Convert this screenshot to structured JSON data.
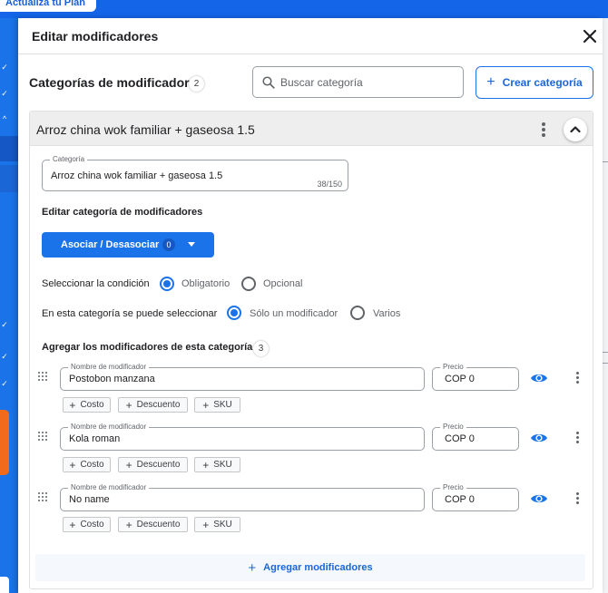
{
  "background": {
    "upgrade_label": "Actualiza tu Plan"
  },
  "panel": {
    "title": "Editar modificadores"
  },
  "categories": {
    "title": "Categorías de modificadores",
    "count": "2",
    "search_placeholder": "Buscar categoría",
    "create_label": "Crear categoría"
  },
  "category": {
    "header_title": "Arroz china wok familiar + gaseosa 1.5",
    "name_label": "Categoría",
    "name_value": "Arroz china wok familiar + gaseosa 1.5",
    "char_count": "38/150",
    "edit_title": "Editar categoría de modificadores",
    "associate_label": "Asociar / Desasociar",
    "associate_count": "0",
    "condition_label": "Seleccionar la condición",
    "condition_options": [
      "Obligatorio",
      "Opcional"
    ],
    "condition_selected": "Obligatorio",
    "selection_label": "En esta categoría se puede seleccionar",
    "selection_options": [
      "Sólo un modificador",
      "Varios"
    ],
    "selection_selected": "Sólo un modificador",
    "modifiers_title": "Agregar los modificadores de esta categoría",
    "modifiers_count": "3",
    "modifier_name_label": "Nombre de modificador",
    "price_label": "Precio",
    "chips": [
      "Costo",
      "Descuento",
      "SKU"
    ],
    "modifiers": [
      {
        "name": "Postobon manzana",
        "price": "COP 0"
      },
      {
        "name": "Kola roman",
        "price": "COP 0"
      },
      {
        "name": "No name",
        "price": "COP 0"
      }
    ],
    "add_modifiers_label": "Agregar modificadores"
  },
  "colors": {
    "primary": "#1a73e8",
    "accent_orange": "#f26a1b",
    "header_gray": "#eeeeee"
  },
  "icons": {
    "close": "close-icon",
    "search": "search-icon",
    "plus": "plus-icon",
    "kebab": "more-vertical-icon",
    "collapse": "chevron-up-icon",
    "drag": "drag-handle-icon",
    "visibility": "eye-icon",
    "dropdown": "caret-down-icon"
  }
}
